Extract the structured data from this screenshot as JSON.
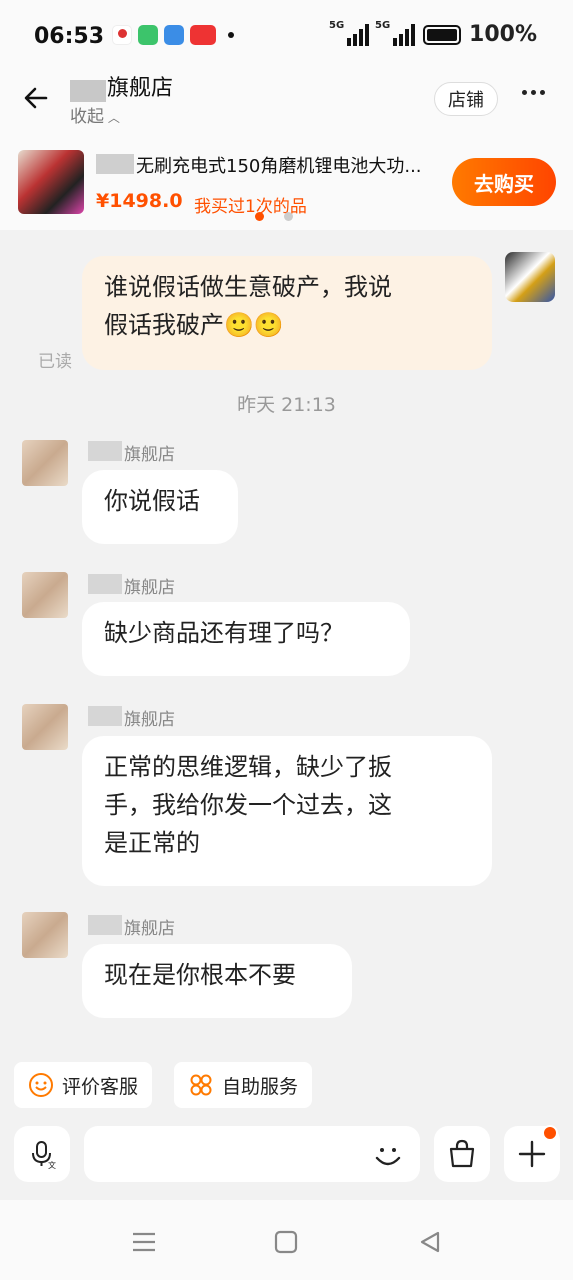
{
  "status_bar": {
    "time": "06:53",
    "network_tags": [
      "5G",
      "5G"
    ],
    "battery": "100%"
  },
  "header": {
    "shop_name": "旗舰店",
    "collapse_label": "收起",
    "shop_button": "店铺",
    "back_icon": "back-arrow-icon",
    "more_icon": "more-dots-icon"
  },
  "product": {
    "title": "无刷充电式150角磨机锂电池大功...",
    "price": "¥1498.0",
    "bought_label": "我买过1次的品",
    "buy_button": "去购买",
    "carousel_pages": 2,
    "carousel_active": 0
  },
  "messages": {
    "mine_1": {
      "lines": [
        "谁说假话做生意破产，我说",
        "假话我破产🙂🙂"
      ],
      "status": "已读"
    },
    "timestamp": "昨天  21:13",
    "theirs": [
      {
        "sender": "旗舰店",
        "lines": [
          "你说假话"
        ]
      },
      {
        "sender": "旗舰店",
        "lines": [
          "缺少商品还有理了吗？"
        ]
      },
      {
        "sender": "旗舰店",
        "lines": [
          "正常的思维逻辑，缺少了扳",
          "手，我给你发一个过去，这",
          "是正常的"
        ]
      },
      {
        "sender": "旗舰店",
        "lines": [
          "现在是你根本不要"
        ]
      }
    ]
  },
  "quick_actions": {
    "rate_service": "评价客服",
    "self_service": "自助服务"
  },
  "input": {
    "voice_icon": "voice-icon",
    "emoji_icon": "smile-icon",
    "bag_icon": "shopping-bag-icon",
    "plus_icon": "plus-icon"
  },
  "colors": {
    "accent": "#ff5000",
    "my_bubble": "#fdf2e4",
    "their_bubble": "#ffffff",
    "background": "#f2f2f2"
  }
}
